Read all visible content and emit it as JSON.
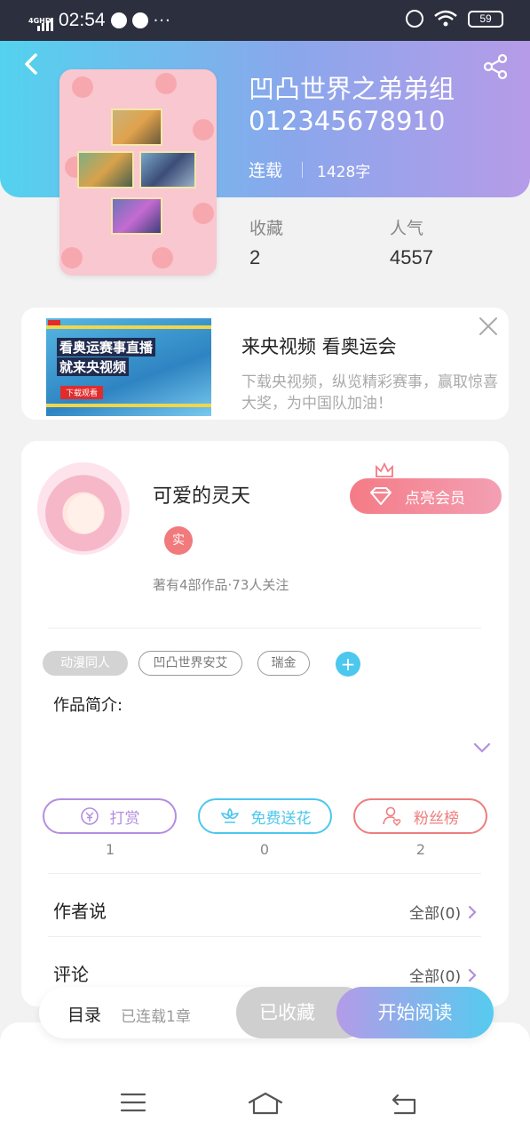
{
  "status_bar": {
    "time": "02:54",
    "network": "4GHD",
    "battery": "59"
  },
  "book": {
    "title": "凹凸世界之弟弟组 012345678910",
    "status": "连载",
    "word_count": "1428字",
    "collect_label": "收藏",
    "collect_count": "2",
    "popularity_label": "人气",
    "popularity_count": "4557"
  },
  "ad": {
    "image_text_line1": "看奥运赛事直播",
    "image_text_line2": "就来央视频",
    "image_button": "下载观看",
    "title": "来央视频 看奥运会",
    "description": "下载央视频，纵览精彩赛事，赢取惊喜大奖，为中国队加油！"
  },
  "author": {
    "name": "可爱的灵天",
    "verify_badge": "实",
    "meta": "著有4部作品·73人关注",
    "vip_button": "点亮会员"
  },
  "tags": [
    "动漫同人",
    "凹凸世界安艾",
    "瑞金"
  ],
  "intro_label": "作品简介:",
  "actions": [
    {
      "label": "打赏",
      "count": "1",
      "color": "#b38ee0"
    },
    {
      "label": "免费送花",
      "count": "0",
      "color": "#4cc7ee"
    },
    {
      "label": "粉丝榜",
      "count": "2",
      "color": "#ee7d7d"
    }
  ],
  "rows": {
    "author_says": {
      "label": "作者说",
      "link": "全部(0)"
    },
    "comments": {
      "label": "评论",
      "link": "全部(0)"
    }
  },
  "bottom_bar": {
    "toc_label": "目录",
    "toc_status": "已连载1章",
    "collected_button": "已收藏",
    "read_button": "开始阅读"
  },
  "colors": {
    "accent_purple": "#b69be8",
    "accent_cyan": "#53d2ee",
    "vip_pink": "#f47b86"
  }
}
